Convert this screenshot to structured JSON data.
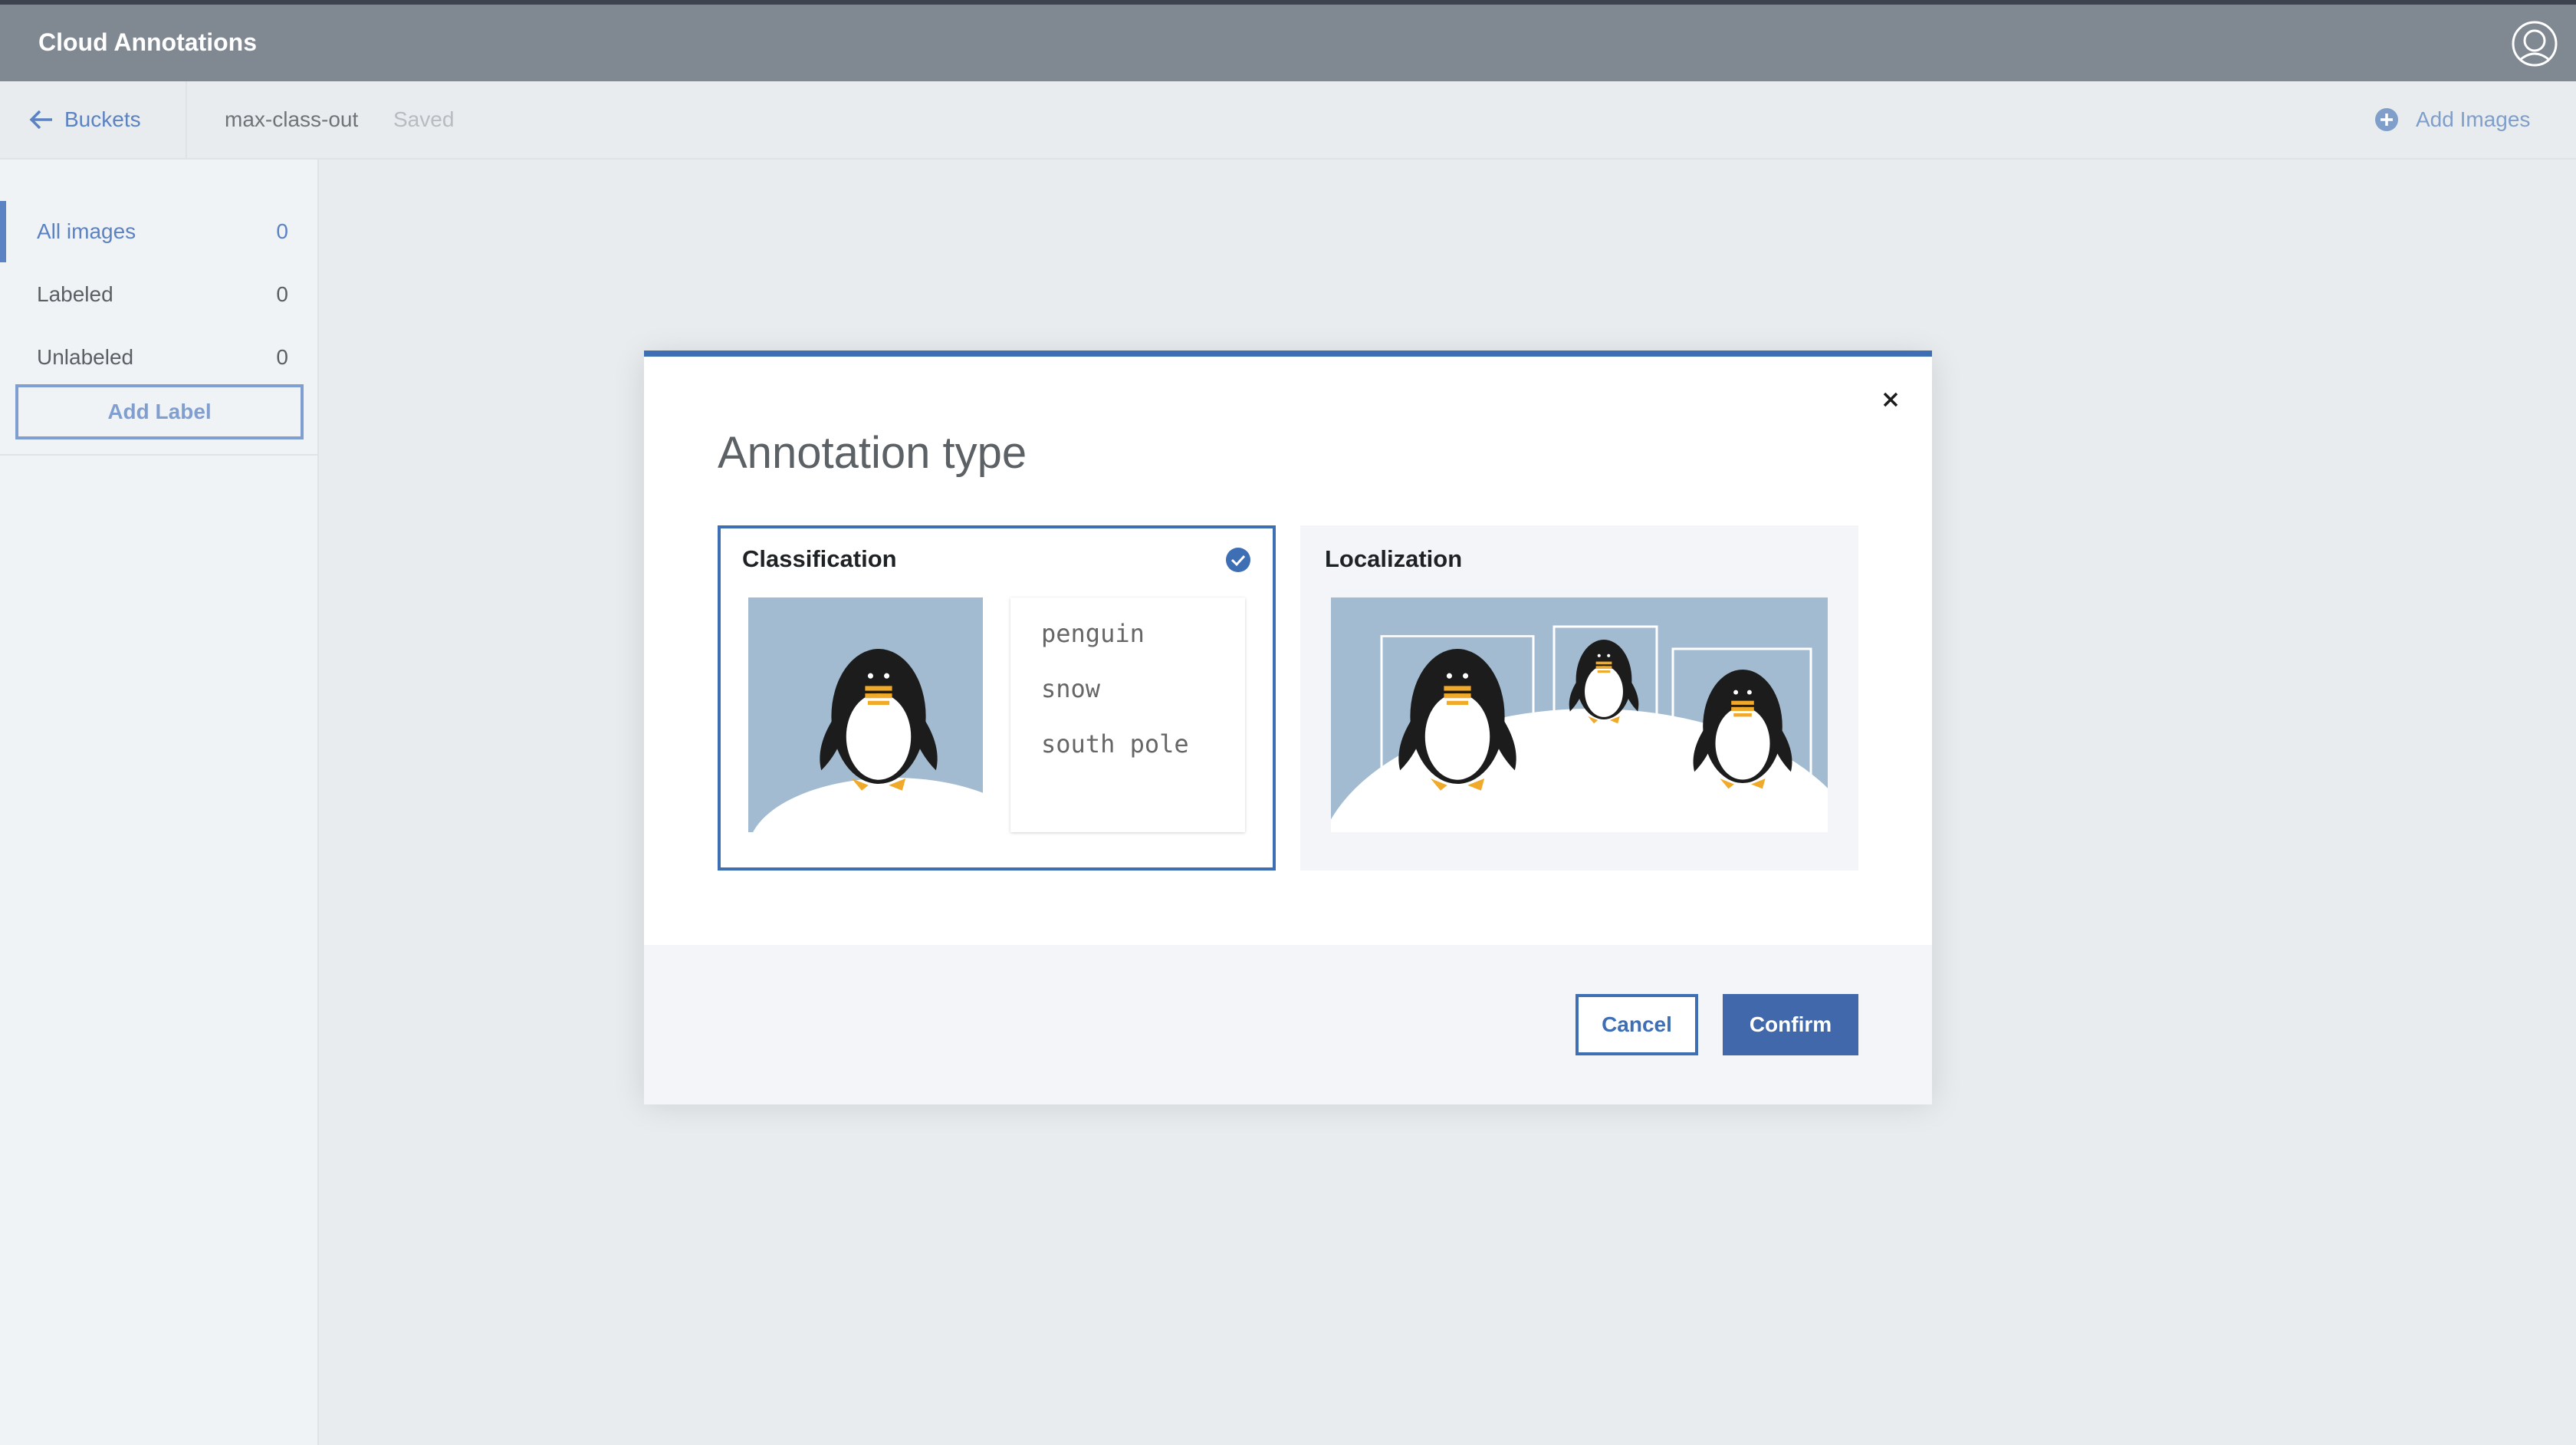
{
  "app": {
    "title": "Cloud Annotations"
  },
  "toolbar": {
    "back_label": "Buckets",
    "bucket_name": "max-class-out",
    "save_status": "Saved",
    "add_images_label": "Add Images"
  },
  "sidebar": {
    "items": [
      {
        "label": "All images",
        "count": "0",
        "active": true
      },
      {
        "label": "Labeled",
        "count": "0",
        "active": false
      },
      {
        "label": "Unlabeled",
        "count": "0",
        "active": false
      }
    ],
    "add_label_button": "Add Label"
  },
  "modal": {
    "title": "Annotation type",
    "options": [
      {
        "title": "Classification",
        "selected": true,
        "tags": [
          "penguin",
          "snow",
          "south pole"
        ]
      },
      {
        "title": "Localization",
        "selected": false
      }
    ],
    "cancel_label": "Cancel",
    "confirm_label": "Confirm"
  },
  "colors": {
    "accent": "#3e6fb5",
    "header_bg": "#808891",
    "sky": "#a3bbd1",
    "beak": "#f0a928"
  },
  "icons": [
    "user-icon",
    "arrow-left-icon",
    "plus-circle-icon",
    "close-icon",
    "checkmark-icon",
    "penguin-illustration"
  ]
}
